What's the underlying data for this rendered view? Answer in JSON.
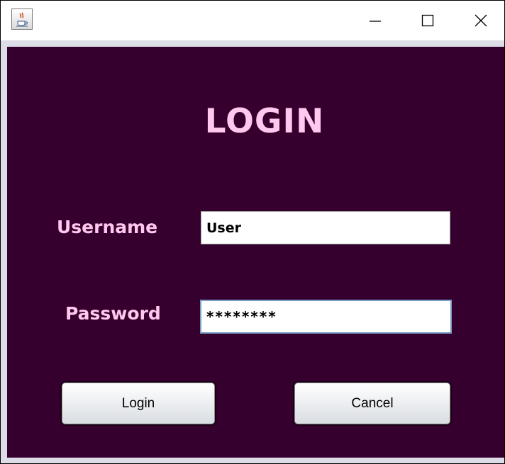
{
  "window": {
    "controls": {
      "minimize_icon": "minimize-icon",
      "maximize_icon": "maximize-icon",
      "close_icon": "close-icon"
    },
    "app_icon": "java-coffee-cup-icon"
  },
  "form": {
    "title": "LOGIN",
    "username_label": "Username",
    "username_value": "User",
    "password_label": "Password",
    "password_value": "********",
    "login_button": "Login",
    "cancel_button": "Cancel"
  },
  "colors": {
    "background": "#35002e",
    "label_text": "#ffc9ef",
    "frame": "#dcdde6"
  }
}
